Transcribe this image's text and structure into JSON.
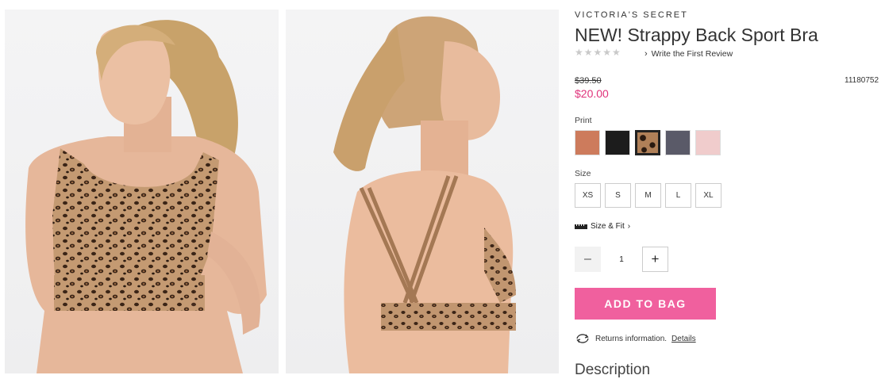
{
  "brand": "VICTORIA'S SECRET",
  "product": {
    "title": "NEW! Strappy Back Sport Bra",
    "review_link": "Write the First Review",
    "old_price": "$39.50",
    "new_price": "$20.00",
    "item_number": "11180752"
  },
  "print": {
    "label": "Print",
    "selected_index": 2,
    "swatches": [
      {
        "name": "copper",
        "color": "#cd7b5c"
      },
      {
        "name": "black",
        "color": "#1c1c1c"
      },
      {
        "name": "leopard",
        "color": "#b08058"
      },
      {
        "name": "charcoal-heather",
        "color": "#5a5a68"
      },
      {
        "name": "pink-heather",
        "color": "#f0cccc"
      }
    ]
  },
  "size": {
    "label": "Size",
    "options": [
      "XS",
      "S",
      "M",
      "L",
      "XL"
    ]
  },
  "size_fit": "Size & Fit",
  "quantity": {
    "value": "1",
    "minus": "–",
    "plus": "+"
  },
  "add_to_bag": "ADD TO BAG",
  "returns": {
    "text": "Returns information.",
    "link": "Details"
  },
  "description_heading": "Description"
}
